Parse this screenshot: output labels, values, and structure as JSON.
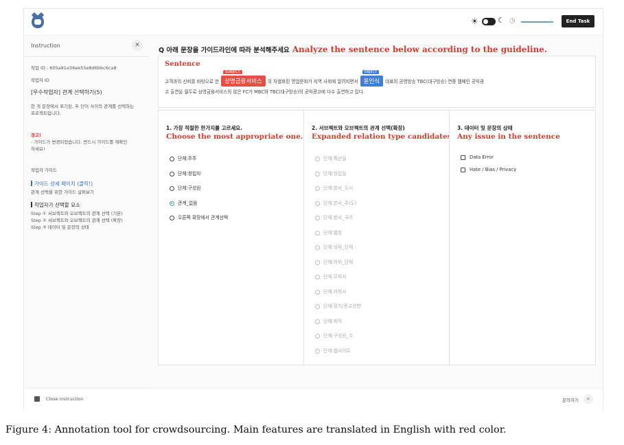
{
  "topbar": {
    "end_task": "End Task",
    "progress_fraction": 1.0
  },
  "sidebar": {
    "title": "Instruction",
    "task_id": "작업 ID : 605a91e36ee55e8d6bbc6ca8",
    "worker_id": "작업자 ID",
    "task_title": "[우수작업자] 관계 선택하기(5)",
    "task_desc_1": "한 개 문장에서 표기된, 두 단어 사이의 관계를 선택하는",
    "task_desc_2": "프로젝트입니다.",
    "warning_label": "경고!",
    "warning_1": "- 가이드가 변경되었습니다. 반드시 가이드를 재확인",
    "warning_2": "하세요!",
    "guide_heading": "작업자 가이드",
    "guide_link": "가이드 상세 페이지 (클릭!)",
    "guide_link_sub": "관계 선택을 위한 가이드 살펴보기",
    "steps_heading": "작업자가 선택할 요소",
    "steps": [
      "Step ① 서브젝트와 오브젝트의 관계 선택 (기본)",
      "Step ② 서브젝트와 오브젝트의 관계 선택 (확장)",
      "Step ③ 데이터 및 문장의 상태"
    ]
  },
  "question": {
    "ko": "Q 아래 문장을 가이드라인에 따라 분석해주세요",
    "en": "Analyze the sentence below according to the guideline."
  },
  "sentence": {
    "label": "Sentence",
    "line1_a": "고객과의 신뢰를 바탕으로 한",
    "subject_tag": "SUBJECT",
    "subject": "상명금융서비스",
    "line1_b": "의 차별화된 영업문화가 지역 사회에 알려지면서",
    "object_tag": "OBJECT",
    "object": "윤인식",
    "line1_c": "대표의 공영방송 TBC(대구방송) 연중 캠페인 공익광",
    "line2": "고 출연을 필두로 상명금융서비스의 많은 FC가 MBC와 TBC(대구방송)의 공익광고에 다수 출연하고 있다."
  },
  "columns": [
    {
      "title_ko": "1. 가장 적절한 한가지를 고르세요.",
      "title_en": "Choose the most appropriate one.",
      "options": [
        "단체:주주",
        "단체:창립자",
        "단체:구성원",
        "관계_없음",
        "오른쪽 확장에서 관계선택"
      ],
      "selected_index": 3
    },
    {
      "title_ko": "2. 서브젝트와 오브젝트의 관계 선택(확장)",
      "title_en": "Expanded relation type candidates",
      "options": [
        "단체:해산일",
        "단체:창립일",
        "단체:본사_도시",
        "단체:본사_주(도)",
        "단체:본사_국가",
        "단체:별칭",
        "단체:상위_단체",
        "단체:하위_단체",
        "단체:모회사",
        "단체:자회사",
        "단체:정치/종교성향",
        "단체:제작",
        "단체:구성원_수",
        "단체:웹사이트"
      ]
    },
    {
      "title_ko": "3. 데이터 및 문장의 상태",
      "title_en": "Any issue in the sentence",
      "options": [
        "Data Error",
        "Hate / Bias / Privacy"
      ]
    }
  ],
  "footer": {
    "close_instruction": "Close Instruction",
    "help": "문의하기"
  },
  "caption": "Figure 4: Annotation tool for crowdsourcing. Main features are translated in English with red color."
}
